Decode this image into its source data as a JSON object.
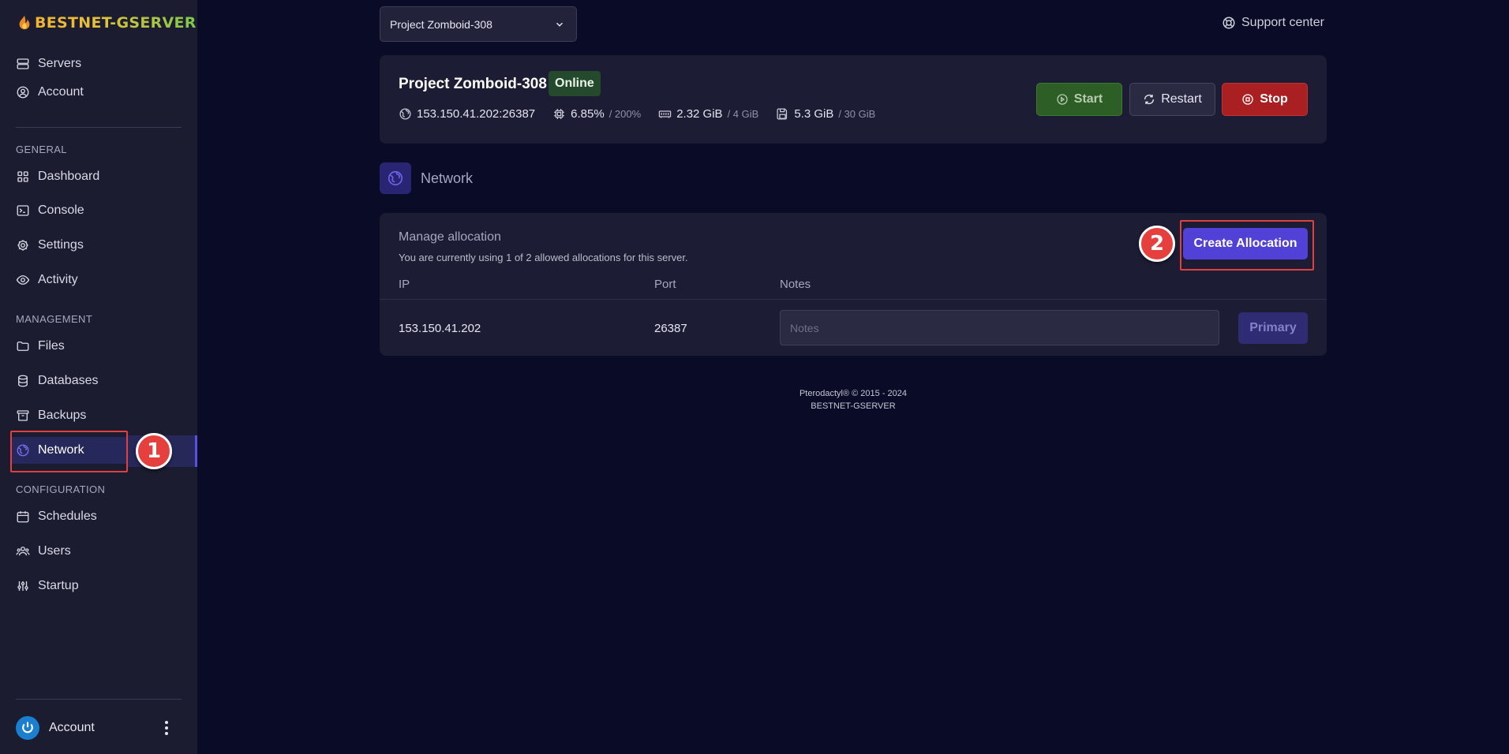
{
  "app": {
    "logo_text": "BESTNET-GSERVER",
    "support_label": "Support center"
  },
  "sidebar": {
    "top_items": [
      {
        "label": "Servers",
        "icon": "server-icon"
      },
      {
        "label": "Account",
        "icon": "user-circle-icon"
      }
    ],
    "sections": [
      {
        "label": "GENERAL",
        "items": [
          {
            "label": "Dashboard",
            "icon": "grid-icon"
          },
          {
            "label": "Console",
            "icon": "terminal-icon"
          },
          {
            "label": "Settings",
            "icon": "gear-icon"
          },
          {
            "label": "Activity",
            "icon": "eye-icon"
          }
        ]
      },
      {
        "label": "MANAGEMENT",
        "items": [
          {
            "label": "Files",
            "icon": "folder-icon"
          },
          {
            "label": "Databases",
            "icon": "database-icon"
          },
          {
            "label": "Backups",
            "icon": "archive-icon"
          },
          {
            "label": "Network",
            "icon": "globe-icon",
            "active": true
          }
        ]
      },
      {
        "label": "CONFIGURATION",
        "items": [
          {
            "label": "Schedules",
            "icon": "calendar-icon"
          },
          {
            "label": "Users",
            "icon": "users-icon"
          },
          {
            "label": "Startup",
            "icon": "sliders-icon"
          }
        ]
      }
    ],
    "bottom_account_label": "Account"
  },
  "annotations": {
    "step1": "1",
    "step2": "2",
    "highlight_color": "#e0413f"
  },
  "server_select": {
    "selected": "Project Zomboid-308"
  },
  "server": {
    "name": "Project Zomboid-308",
    "status": "Online",
    "address": "153.150.41.202:26387",
    "cpu": "6.85%",
    "cpu_limit": "/ 200%",
    "memory": "2.32 GiB",
    "memory_limit": "/ 4 GiB",
    "disk": "5.3 GiB",
    "disk_limit": "/ 30 GiB",
    "start_label": "Start",
    "restart_label": "Restart",
    "stop_label": "Stop"
  },
  "network": {
    "title": "Network",
    "manage_title": "Manage allocation",
    "description": "You are currently using 1 of 2 allowed allocations for this server.",
    "create_label": "Create Allocation",
    "columns": {
      "ip": "IP",
      "port": "Port",
      "notes": "Notes"
    },
    "rows": [
      {
        "ip": "153.150.41.202",
        "port": "26387",
        "notes_value": "",
        "notes_placeholder": "Notes",
        "tag": "Primary"
      }
    ]
  },
  "footer": {
    "line1": "Pterodactyl® © 2015 - 2024",
    "line2": "BESTNET-GSERVER"
  },
  "colors": {
    "accent": "#5241d6",
    "start": "#2d5e25",
    "stop": "#a91f22",
    "online": "#24492c"
  }
}
